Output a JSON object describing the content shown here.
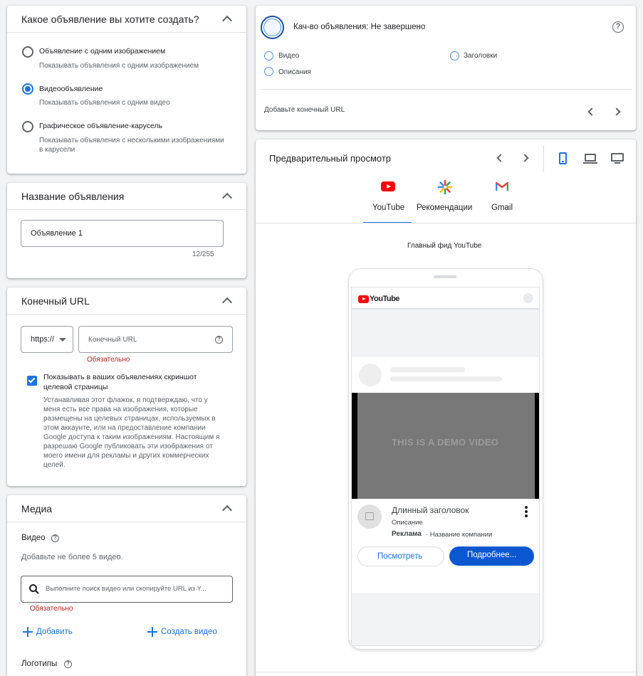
{
  "ad_type": {
    "title": "Какое объявление вы хотите создать?",
    "options": [
      {
        "label": "Объявление с одним изображением",
        "desc": "Показывать объявления с одним изображением",
        "selected": false
      },
      {
        "label": "Видеообъявление",
        "desc": "Показывать объявления с одним видео",
        "selected": true
      },
      {
        "label": "Графическое объявление-карусель",
        "desc": "Показывать объявления с несколькими изображениями",
        "desc2": "в карусели",
        "selected": false
      }
    ]
  },
  "ad_name": {
    "title": "Название объявления",
    "value": "Объявление 1",
    "counter": "12/255"
  },
  "final_url": {
    "title": "Конечный URL",
    "protocol": "https://",
    "placeholder": "Конечный URL",
    "required": "Обязательно",
    "checkbox_label_1": "Показывать в ваших объявлениях скриншот",
    "checkbox_label_2": "целевой страницы",
    "checkbox_checked": true,
    "disclaimer": [
      "Устанавливая этот флажок, я подтверждаю, что у",
      "меня есть все права на изображения, которые",
      "размещены на целевых страницах, используемых в",
      "этом аккаунте, или на предоставление компании",
      "Google доступа к таким изображениям. Настоящим я",
      "разрешаю Google публиковать эти изображения от",
      "моего имени для рекламы и других коммерческих",
      "целей."
    ]
  },
  "media": {
    "title": "Медиа",
    "video_label": "Видео",
    "video_hint": "Добавьте не более 5 видео.",
    "search_placeholder": "Выполните поиск видео или скопируйте URL из Y...",
    "required": "Обязательно",
    "add_label": "Добавить",
    "create_label": "Создать видео",
    "logos_label": "Логотипы"
  },
  "quality": {
    "title": "Кач-во объявления: Не завершено",
    "items": [
      "Видео",
      "Заголовки",
      "Описания"
    ],
    "hint": "Добавьте конечный URL"
  },
  "preview": {
    "title": "Предварительный просмотр",
    "tabs": [
      "YouTube",
      "Рекомендации",
      "Gmail"
    ],
    "active_tab": "YouTube",
    "feed_label": "Главный фид YouTube",
    "logo_text": "YouTube",
    "demo_text": "THIS IS A DEMO VIDEO",
    "headline": "Длинный заголовок",
    "description": "Описание",
    "ad_badge": "Реклама",
    "company": "· Название компании",
    "btn_watch": "Посмотреть",
    "btn_more": "Подробнее...",
    "colors": {
      "accent": "#1a73e8",
      "youtube_red": "#ff0000",
      "cta": "#0b57d0"
    }
  }
}
